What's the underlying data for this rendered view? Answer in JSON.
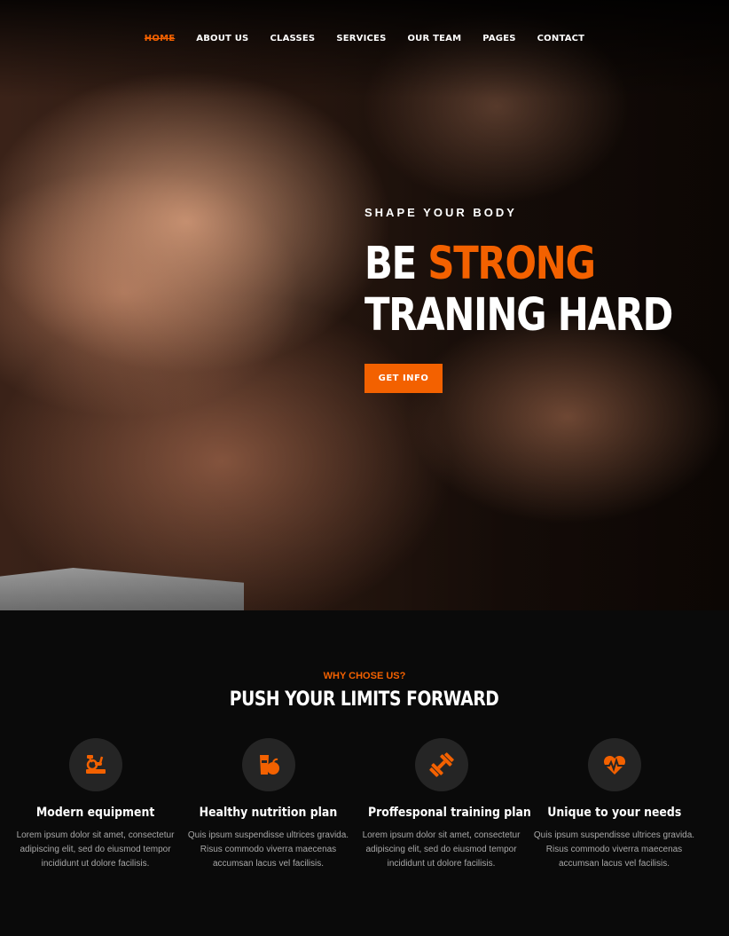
{
  "nav": {
    "items": [
      "HOME",
      "ABOUT US",
      "CLASSES",
      "SERVICES",
      "OUR TEAM",
      "PAGES",
      "CONTACT"
    ],
    "active_index": 0
  },
  "hero": {
    "kicker": "SHAPE YOUR BODY",
    "line1_plain": "BE",
    "line1_accent": "STRONG",
    "line2": "TRANING HARD",
    "cta_label": "GET INFO"
  },
  "features": {
    "eyebrow": "WHY CHOSE US?",
    "title": "PUSH YOUR LIMITS FORWARD",
    "cards": [
      {
        "icon": "exercise-bike-icon",
        "title": "Modern equipment",
        "desc": "Lorem ipsum dolor sit amet, consectetur adipiscing elit, sed do eiusmod tempor incididunt ut dolore facilisis."
      },
      {
        "icon": "nutrition-icon",
        "title": "Healthy nutrition plan",
        "desc": "Quis ipsum suspendisse ultrices gravida. Risus commodo viverra maecenas accumsan lacus vel facilisis."
      },
      {
        "icon": "dumbbell-icon",
        "title": "Proffesponal training plan",
        "desc": "Lorem ipsum dolor sit amet, consectetur adipiscing elit, sed do eiusmod tempor incididunt ut dolore facilisis."
      },
      {
        "icon": "heart-rate-icon",
        "title": "Unique to your needs",
        "desc": "Quis ipsum suspendisse ultrices gravida. Risus commodo viverra maecenas accumsan lacus vel facilisis."
      }
    ]
  },
  "colors": {
    "accent": "#f36100",
    "background": "#0a0a0a",
    "icon_circle": "#252525"
  }
}
